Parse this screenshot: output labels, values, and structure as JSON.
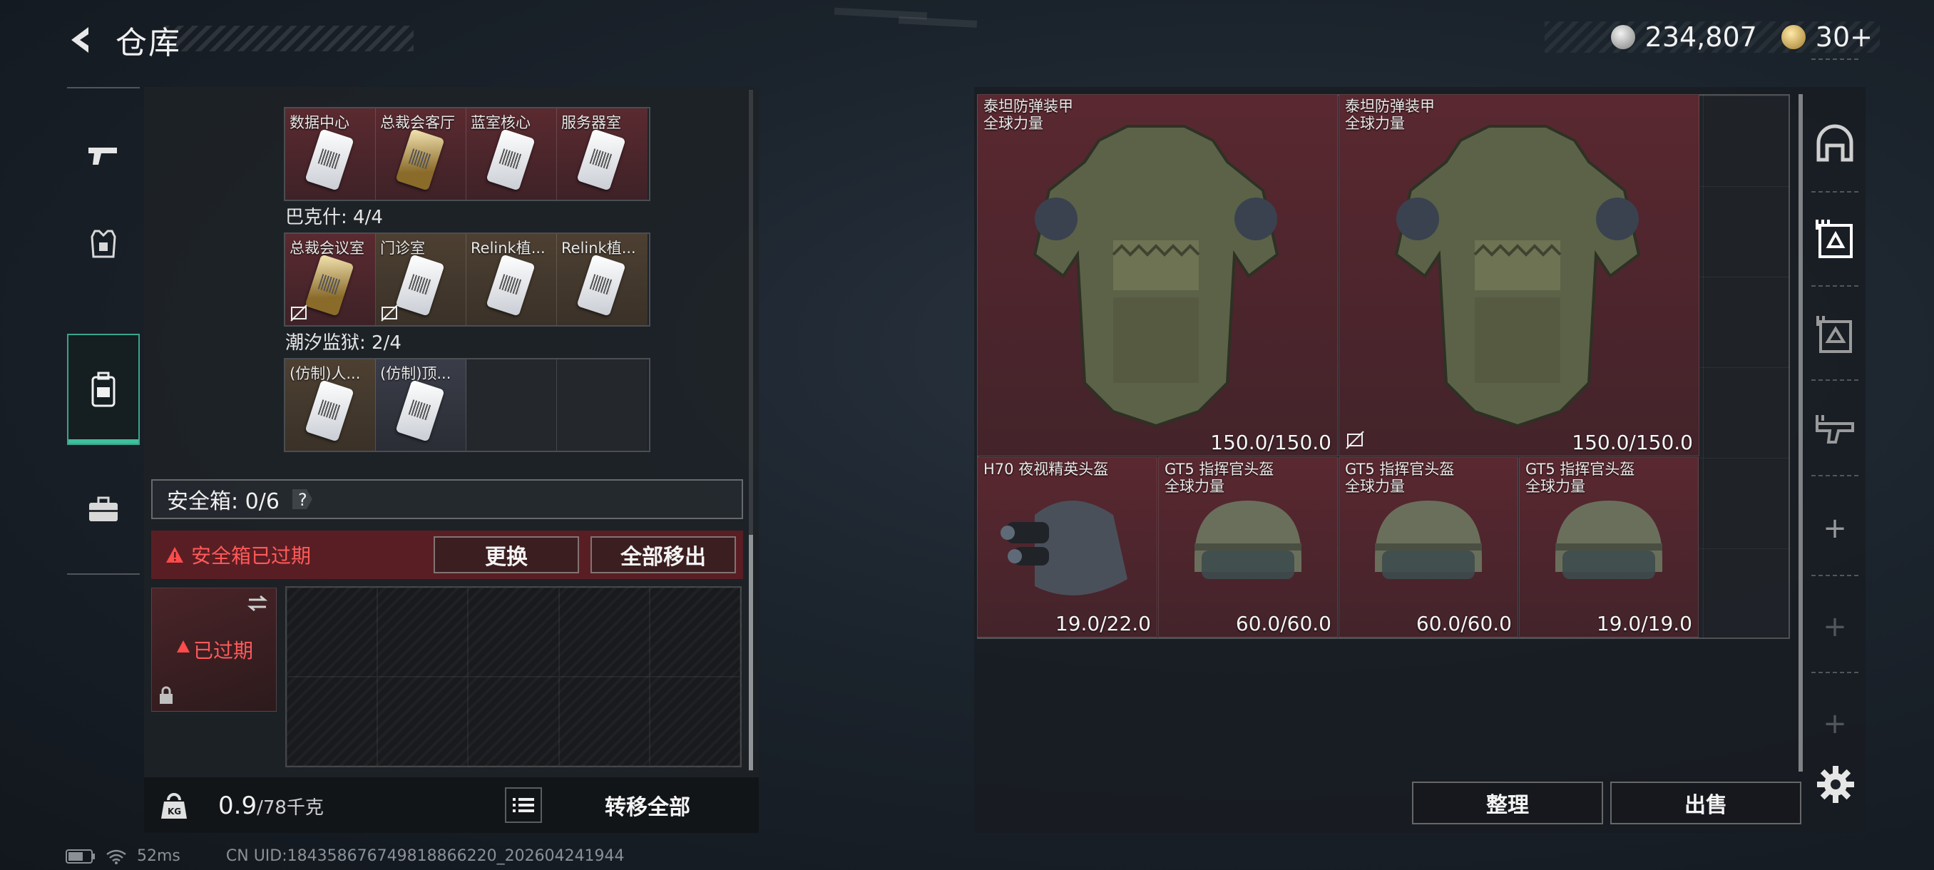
{
  "header": {
    "title": "仓库"
  },
  "currency": [
    {
      "icon": "silver-coin-icon",
      "value": "234,807"
    },
    {
      "icon": "gold-coin-icon",
      "value": "30+"
    }
  ],
  "rail": [
    {
      "icon": "pistol-icon",
      "active": false
    },
    {
      "icon": "armor-vest-icon",
      "active": false
    },
    {
      "icon": "backpack-icon",
      "active": true
    },
    {
      "icon": "briefcase-icon",
      "active": false
    }
  ],
  "keycard_groups": [
    {
      "label": "",
      "cards": [
        {
          "name": "数据中心",
          "style": "red"
        },
        {
          "name": "总裁会客厅",
          "style": "red",
          "gold": true
        },
        {
          "name": "蓝室核心",
          "style": "red"
        },
        {
          "name": "服务器室",
          "style": "red"
        }
      ]
    },
    {
      "label": "巴克什: 4/4",
      "cards": [
        {
          "name": "总裁会议室",
          "style": "red",
          "gold": true,
          "noswap": true
        },
        {
          "name": "门诊室",
          "style": "brown",
          "noswap": true
        },
        {
          "name": "Relink植...",
          "style": "brown"
        },
        {
          "name": "Relink植...",
          "style": "brown"
        }
      ]
    },
    {
      "label": "潮汐监狱: 2/4",
      "cards": [
        {
          "name": "(仿制)人...",
          "style": "brown"
        },
        {
          "name": "(仿制)顶...",
          "style": "gray"
        }
      ]
    }
  ],
  "safe_box": {
    "label": "安全箱: 0/6",
    "expired_notice": "安全箱已过期",
    "replace_button": "更换",
    "move_all_button": "全部移出",
    "item_status": "已过期"
  },
  "footer_left": {
    "weight": "0.9",
    "weight_max": "/78千克",
    "transfer_all": "转移全部"
  },
  "status": {
    "ping": "52ms",
    "uid": "CN UID:18435867674981886622​0_202604241944"
  },
  "inventory": [
    {
      "name": "泰坦防弹装甲",
      "sub": "全球力量",
      "durability": "150.0/150.0",
      "kind": "armor",
      "noswap": false
    },
    {
      "name": "泰坦防弹装甲",
      "sub": "全球力量",
      "durability": "150.0/150.0",
      "kind": "armor",
      "noswap": true
    },
    {
      "name": "H70 夜视精英头盔",
      "sub": "",
      "durability": "19.0/22.0",
      "kind": "nv-helmet"
    },
    {
      "name": "GT5 指挥官头盔",
      "sub": "全球力量",
      "durability": "60.0/60.0",
      "kind": "helmet"
    },
    {
      "name": "GT5 指挥官头盔",
      "sub": "全球力量",
      "durability": "60.0/60.0",
      "kind": "helmet"
    },
    {
      "name": "GT5 指挥官头盔",
      "sub": "全球力量",
      "durability": "19.0/19.0",
      "kind": "helmet"
    }
  ],
  "right_rail": [
    {
      "icon": "helmet-slot-icon"
    },
    {
      "icon": "armor-slot-icon"
    },
    {
      "icon": "chest-rig-slot-icon"
    },
    {
      "icon": "weapon-slot-icon"
    }
  ],
  "bottom_buttons": {
    "organize": "整理",
    "sell": "出售"
  }
}
